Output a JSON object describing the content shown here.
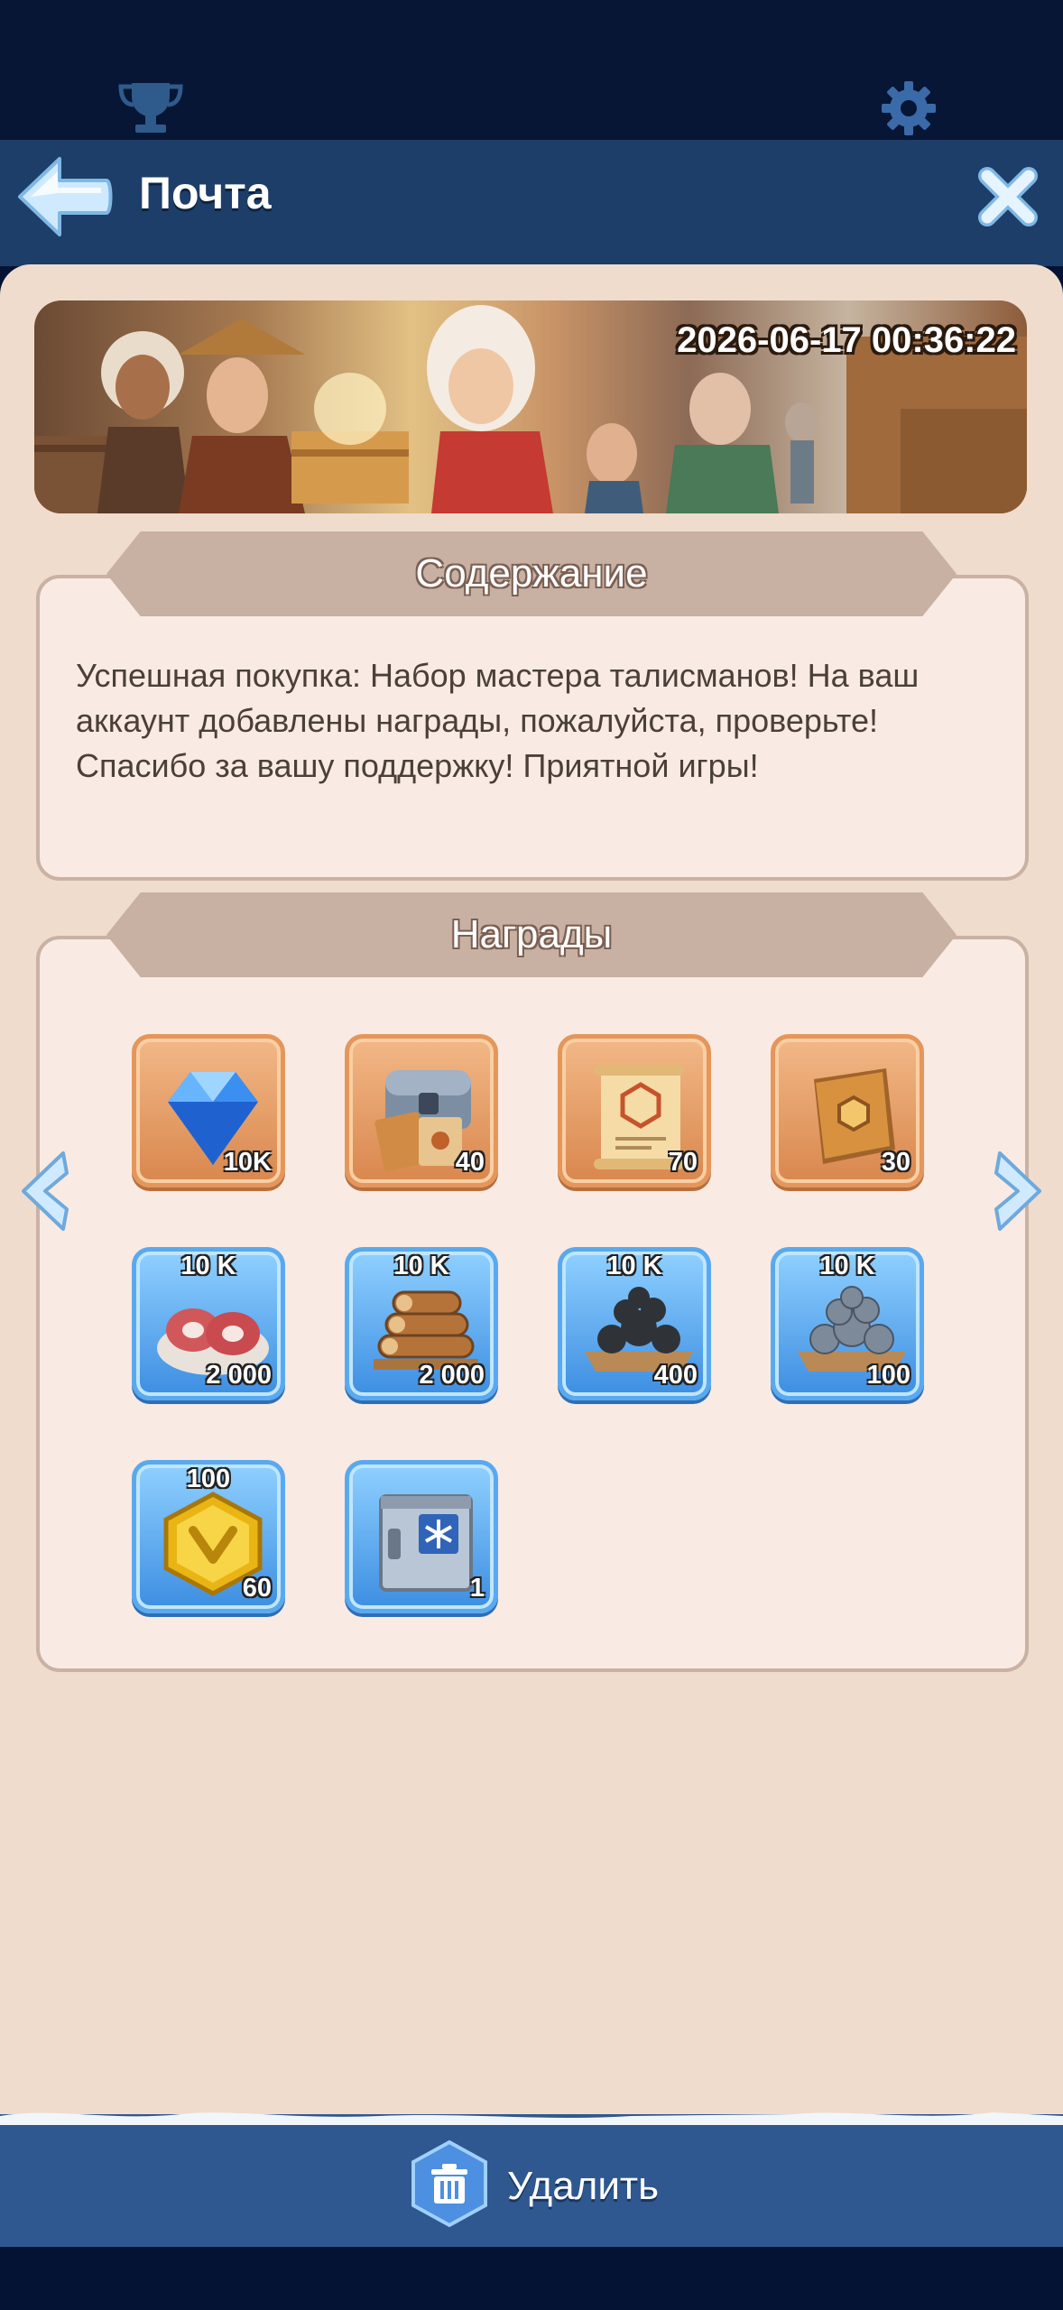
{
  "header": {
    "title": "Почта"
  },
  "banner": {
    "timestamp": "2026-06-17 00:36:22"
  },
  "content": {
    "heading": "Содержание",
    "text": "Успешная покупка: Набор мастера талисманов! На ваш аккаунт добавлены награды, пожалуйста, проверьте! Спасибо за вашу поддержку! Приятной игры!"
  },
  "rewards": {
    "heading": "Награды",
    "items": [
      {
        "icon": "gem-icon",
        "style": "orange",
        "cap": "",
        "qty": "10K"
      },
      {
        "icon": "chest-icon",
        "style": "orange",
        "cap": "",
        "qty": "40"
      },
      {
        "icon": "scroll-icon",
        "style": "orange",
        "cap": "",
        "qty": "70"
      },
      {
        "icon": "book-icon",
        "style": "orange",
        "cap": "",
        "qty": "30"
      },
      {
        "icon": "meat-icon",
        "style": "blue",
        "cap": "10 K",
        "qty": "2 000"
      },
      {
        "icon": "wood-icon",
        "style": "blue",
        "cap": "10 K",
        "qty": "2 000"
      },
      {
        "icon": "coal-icon",
        "style": "blue",
        "cap": "10 K",
        "qty": "400"
      },
      {
        "icon": "iron-icon",
        "style": "blue",
        "cap": "10 K",
        "qty": "100"
      },
      {
        "icon": "gold-hex-icon",
        "style": "blue",
        "cap": "100",
        "qty": "60"
      },
      {
        "icon": "crate-icon",
        "style": "blue",
        "cap": "",
        "qty": "1"
      }
    ]
  },
  "footer": {
    "delete_label": "Удалить"
  }
}
